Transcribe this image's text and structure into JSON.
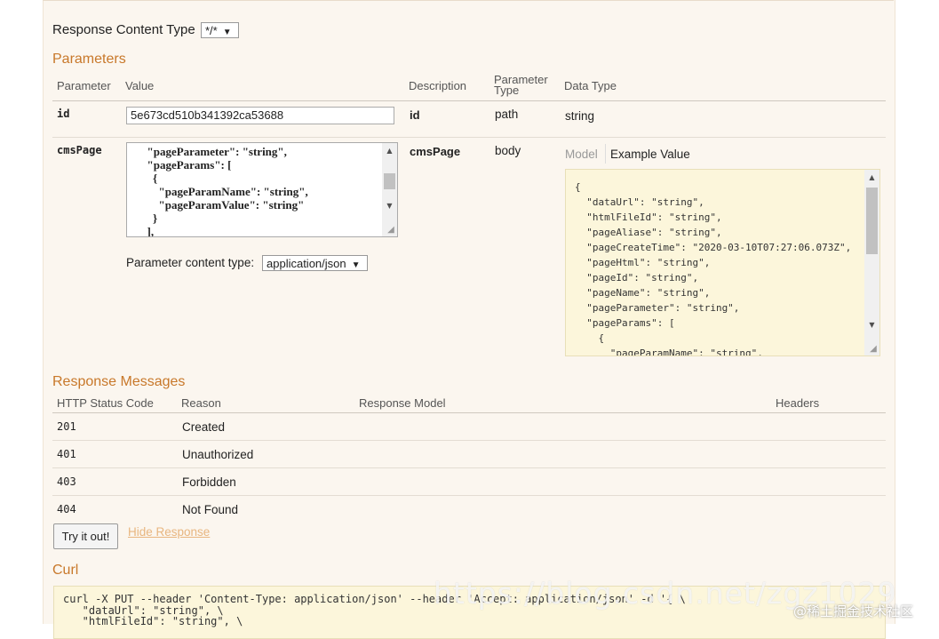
{
  "response_content_type": {
    "label": "Response Content Type",
    "selected": "*/*"
  },
  "parameters": {
    "title": "Parameters",
    "columns": {
      "parameter": "Parameter",
      "value": "Value",
      "description": "Description",
      "parameter_type_line1": "Parameter",
      "parameter_type_line2": "Type",
      "data_type": "Data Type"
    },
    "id_row": {
      "name": "id",
      "value": "5e673cd510b341392ca53688",
      "description": "id",
      "type": "path",
      "data_type": "string"
    },
    "cms_row": {
      "name": "cmsPage",
      "textarea": "  \"pageParameter\": \"string\",\n  \"pageParams\": [\n    {\n      \"pageParamName\": \"string\",\n      \"pageParamValue\": \"string\"\n    }\n  ],",
      "description": "cmsPage",
      "type": "body",
      "content_type_label": "Parameter content type:",
      "content_type_selected": "application/json",
      "model_tab": "Model",
      "example_tab": "Example Value",
      "example_json": "{\n  \"dataUrl\": \"string\",\n  \"htmlFileId\": \"string\",\n  \"pageAliase\": \"string\",\n  \"pageCreateTime\": \"2020-03-10T07:27:06.073Z\",\n  \"pageHtml\": \"string\",\n  \"pageId\": \"string\",\n  \"pageName\": \"string\",\n  \"pageParameter\": \"string\",\n  \"pageParams\": [\n    {\n      \"pageParamName\": \"string\","
    }
  },
  "response_messages": {
    "title": "Response Messages",
    "columns": {
      "status": "HTTP Status Code",
      "reason": "Reason",
      "model": "Response Model",
      "headers": "Headers"
    },
    "rows": [
      {
        "code": "201",
        "reason": "Created"
      },
      {
        "code": "401",
        "reason": "Unauthorized"
      },
      {
        "code": "403",
        "reason": "Forbidden"
      },
      {
        "code": "404",
        "reason": "Not Found"
      }
    ]
  },
  "actions": {
    "try_button": "Try it out!",
    "hide_link": "Hide Response"
  },
  "curl": {
    "title": "Curl",
    "command": "curl -X PUT --header 'Content-Type: application/json' --header 'Accept: application/json' -d '{ \\\n   \"dataUrl\": \"string\", \\\n   \"htmlFileId\": \"string\", \\"
  },
  "watermark": {
    "url": "https://blog.csdn.net/zgz1029",
    "credit": "@稀土掘金技术社区"
  }
}
